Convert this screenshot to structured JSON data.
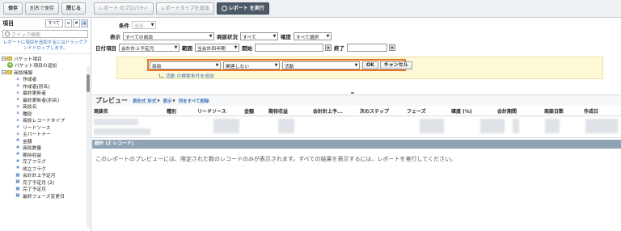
{
  "toolbar": {
    "save": "保存",
    "save_as": "別名で保存",
    "close": "閉じる",
    "report_props": "レポート のプロパティ",
    "add_type": "レポートタイプを追加",
    "run": "レポート を実行"
  },
  "left_panel": {
    "title": "項目",
    "filter_all": "すべて",
    "search_placeholder": "クイック検索",
    "hint": "レポートに項目を追加するにはドラッグアンドドロップします。",
    "tree": [
      {
        "level": 0,
        "kind": "folder",
        "label": "バケット項目"
      },
      {
        "level": 1,
        "kind": "add",
        "label": "バケット項目の追加"
      },
      {
        "level": 0,
        "kind": "folder",
        "label": "商談情報"
      },
      {
        "level": 2,
        "kind": "text",
        "icon": "a",
        "label": "作成者"
      },
      {
        "level": 2,
        "kind": "text",
        "icon": "a",
        "label": "作成者(別名)"
      },
      {
        "level": 2,
        "kind": "text",
        "icon": "a",
        "label": "最終更新者"
      },
      {
        "level": 2,
        "kind": "text",
        "icon": "a",
        "label": "最終更新者(別名)"
      },
      {
        "level": 2,
        "kind": "text",
        "icon": "a",
        "label": "商談名"
      },
      {
        "level": 2,
        "kind": "text",
        "icon": "a",
        "label": "種別"
      },
      {
        "level": 2,
        "kind": "text",
        "icon": "a",
        "label": "商談レコードタイプ"
      },
      {
        "level": 2,
        "kind": "text",
        "icon": "a",
        "label": "リードソース"
      },
      {
        "level": 2,
        "kind": "text",
        "icon": "a",
        "label": "主パートナー"
      },
      {
        "level": 2,
        "kind": "num",
        "icon": "#",
        "label": "金額"
      },
      {
        "level": 2,
        "kind": "num",
        "icon": "#",
        "label": "商談数量"
      },
      {
        "level": 2,
        "kind": "num",
        "icon": "#",
        "label": "期待収益"
      },
      {
        "level": 2,
        "kind": "num",
        "icon": "#",
        "label": "完了フラグ"
      },
      {
        "level": 2,
        "kind": "num",
        "icon": "#",
        "label": "成立フラグ"
      },
      {
        "level": 2,
        "kind": "date",
        "icon": "▦",
        "label": "会計計上予定月"
      },
      {
        "level": 2,
        "kind": "date",
        "icon": "▦",
        "label": "完了予定月 (2)"
      },
      {
        "level": 2,
        "kind": "date",
        "icon": "▦",
        "label": "完了予定月"
      },
      {
        "level": 2,
        "kind": "date",
        "icon": "▦",
        "label": "最終フェーズ変更日"
      }
    ]
  },
  "filters": {
    "condition_label": "条件",
    "condition_add": "追加",
    "show_label": "表示",
    "show_value": "すべての商談",
    "status_label": "商談状況",
    "status_value": "すべて",
    "probability_label": "確度",
    "probability_value": "すべて選択",
    "date_label": "日付項目",
    "date_field": "会計計上予定月",
    "range_label": "範囲",
    "range_value": "当会計四半期",
    "start_label": "開始",
    "end_label": "終了",
    "criteria_field": "商談",
    "criteria_op": "関連しない",
    "criteria_value": "活動",
    "ok": "OK",
    "cancel": "キャンセル",
    "add_filter_link": "活動 の検索条件を追加"
  },
  "preview": {
    "title": "プレビュー",
    "format_link": "表形式 形式",
    "show_link": "表示",
    "remove_link": "列をすべて削除",
    "columns": [
      "商談名",
      "種別",
      "リードソース",
      "金額",
      "期待収益",
      "会計計上予...",
      "次のステップ",
      "フェーズ",
      "確度 (%)",
      "会計期間",
      "商談日数",
      "作成日"
    ],
    "summary": "総計 (2 レコード)",
    "notice": "このレポートのプレビューには、限定された数のレコードのみが表示されます。すべての結果を表示するには、レポートを実行してください。"
  },
  "colors": {
    "highlight": "#e8742a",
    "filter_band": "#fdf8d6",
    "summary_bar": "#8fa3b4",
    "link": "#3a70b8"
  }
}
